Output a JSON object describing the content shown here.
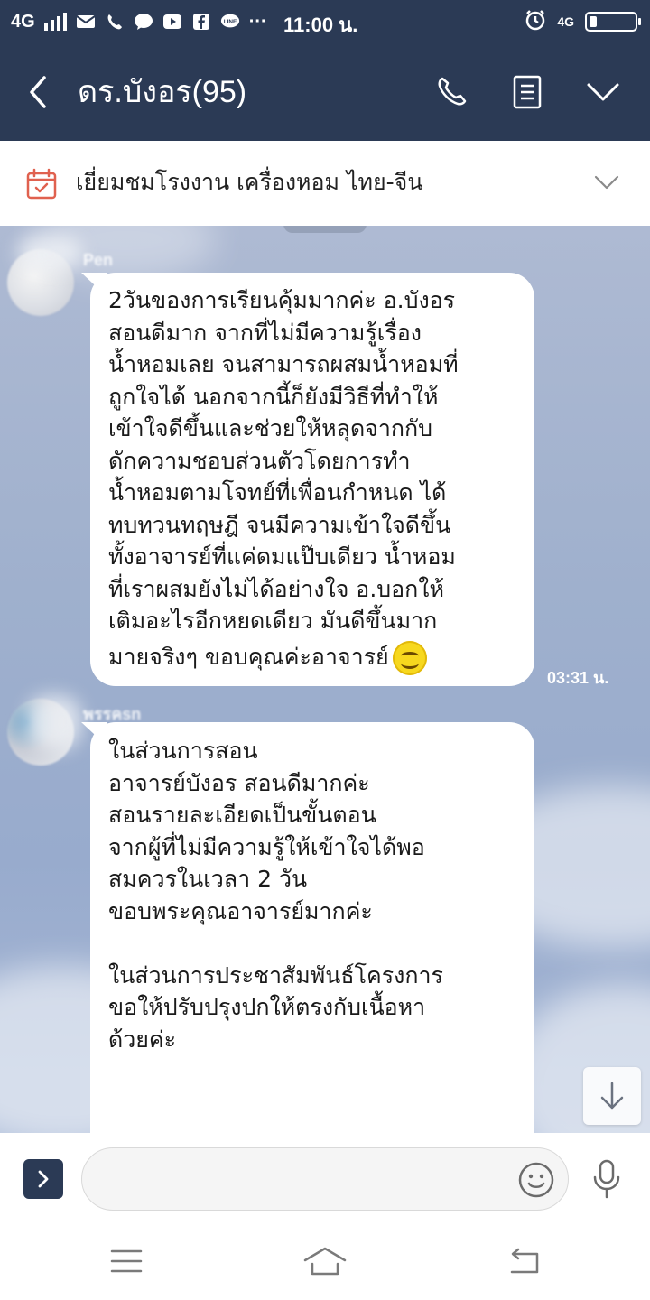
{
  "status_bar": {
    "network": "4G",
    "time": "11:00 น.",
    "right_network": "4G",
    "icons": [
      "signal-icon",
      "mail-icon",
      "phone-icon",
      "chat-icon",
      "youtube-icon",
      "facebook-icon",
      "line-icon",
      "more-icon",
      "alarm-icon",
      "battery-icon"
    ],
    "more_label": "···"
  },
  "header": {
    "title": "ดร.บังอร(95)",
    "icons": [
      "back-icon",
      "phone-icon",
      "notes-icon",
      "chevron-down-icon"
    ]
  },
  "pinned": {
    "text": "เยี่ยมชมโรงงาน เครื่องหอม ไทย-จีน",
    "icons": [
      "calendar-icon",
      "chevron-down-icon"
    ]
  },
  "messages": [
    {
      "sender": "Pen",
      "lines": [
        "2วันของการเรียนคุ้มมากค่ะ อ.บังอร",
        "สอนดีมาก จากที่ไม่มีความรู้เรื่อง",
        "น้ำหอมเลย จนสามารถผสมน้ำหอมที่",
        "ถูกใจได้ นอกจากนี้ก็ยังมีวิธีที่ทำให้",
        "เข้าใจดีขึ้นและช่วยให้หลุดจากกับ",
        "ดักความชอบส่วนตัวโดยการทำ",
        "น้ำหอมตามโจทย์ที่เพื่อนกำหนด ได้",
        "ทบทวนทฤษฎี จนมีความเข้าใจดีขึ้น",
        "ทั้งอาจารย์ที่แค่ดมแป๊บเดียว น้ำหอม",
        "ที่เราผสมยังไม่ได้อย่างใจ อ.บอกให้",
        "เติมอะไรอีกหยดเดียว มันดีขึ้นมาก",
        "มายจริงๆ ขอบคุณค่ะอาจารย์"
      ],
      "time": "03:31 น."
    },
    {
      "sender": "พรรคsn",
      "lines": [
        "ในส่วนการสอน",
        "อาจารย์บังอร สอนดีมากค่ะ",
        "สอนรายละเอียดเป็นขั้นตอน",
        "จากผู้ที่ไม่มีความรู้ให้เข้าใจได้พอ",
        "สมควรในเวลา 2 วัน",
        "ขอบพระคุณอาจารย์มากค่ะ",
        "",
        "ในส่วนการประชาสัมพันธ์โครงการ",
        "ขอให้ปรับปรุงปกให้ตรงกับเนื้อหา",
        "ด้วยค่ะ"
      ]
    }
  ],
  "input": {
    "placeholder": "",
    "value": ""
  },
  "nav_bar": {
    "icons": [
      "menu-icon",
      "home-icon",
      "back-icon"
    ]
  },
  "colors": {
    "header_bg": "#2b3a55",
    "chat_bg": "#a3b4d2",
    "bubble_bg": "#ffffff",
    "pinned_icon": "#e0614f"
  }
}
